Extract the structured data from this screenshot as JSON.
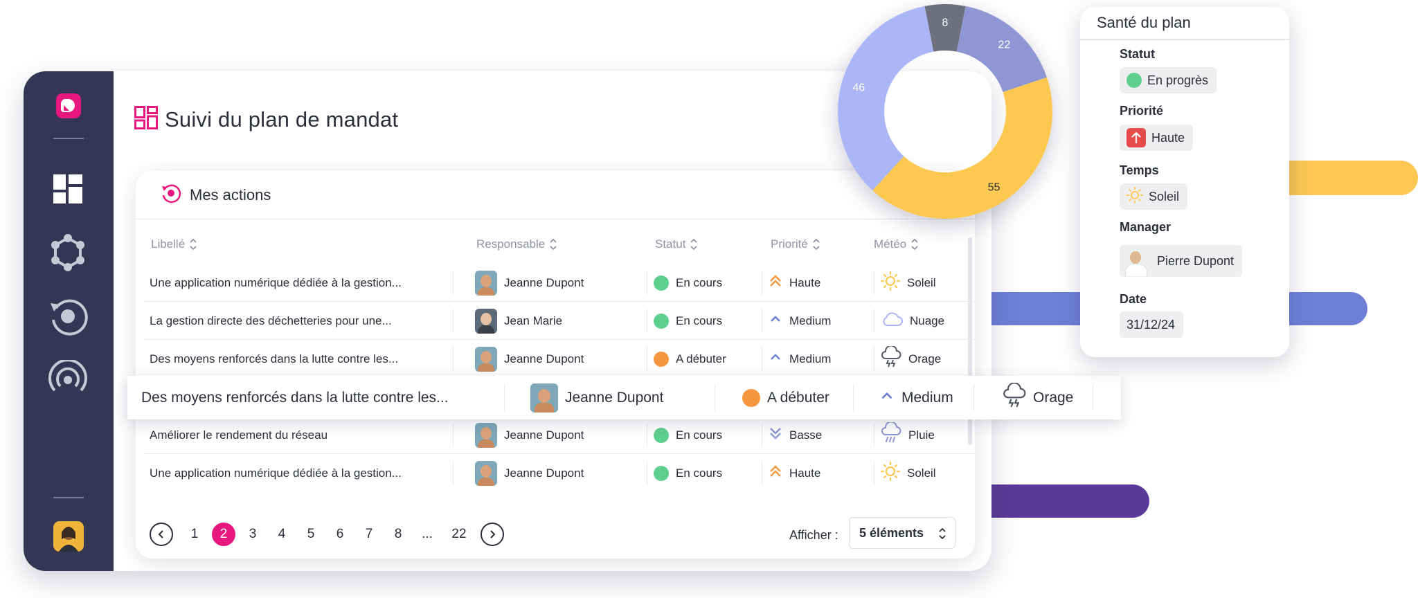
{
  "app": {
    "page_title": "Suivi du plan de mandat"
  },
  "table": {
    "title": "Mes actions",
    "columns": [
      "Libellé",
      "Responsable",
      "Statut",
      "Priorité",
      "Météo"
    ],
    "rows": [
      {
        "label": "Une application numérique dédiée à la gestion...",
        "owner": "Jeanne Dupont",
        "status": "En cours",
        "status_color": "#5fcf8f",
        "priority": "Haute",
        "weather": "Soleil"
      },
      {
        "label": "La gestion directe des déchetteries pour une...",
        "owner": "Jean Marie",
        "status": "En cours",
        "status_color": "#5fcf8f",
        "priority": "Medium",
        "weather": "Nuage"
      },
      {
        "label": "Des moyens renforcés dans la lutte contre les...",
        "owner": "Jeanne Dupont",
        "status": "A débuter",
        "status_color": "#f6973f",
        "priority": "Medium",
        "weather": "Orage"
      },
      {
        "label": "Améliorer le rendement du réseau",
        "owner": "Jeanne Dupont",
        "status": "En cours",
        "status_color": "#5fcf8f",
        "priority": "Basse",
        "weather": "Pluie"
      },
      {
        "label": "Une application numérique dédiée à la gestion...",
        "owner": "Jeanne Dupont",
        "status": "En cours",
        "status_color": "#5fcf8f",
        "priority": "Haute",
        "weather": "Soleil"
      }
    ],
    "highlight": {
      "label": "Des moyens renforcés dans la lutte contre les...",
      "owner": "Jeanne Dupont",
      "status": "A débuter",
      "status_color": "#f6973f",
      "priority": "Medium",
      "weather": "Orage"
    }
  },
  "pagination": {
    "pages": [
      "1",
      "2",
      "3",
      "4",
      "5",
      "6",
      "7",
      "8",
      "...",
      "22"
    ],
    "current": "2",
    "show_label": "Afficher :",
    "page_size": "5 éléments"
  },
  "donut": {
    "segments": [
      {
        "value": 8,
        "color": "#6e717d"
      },
      {
        "value": 22,
        "color": "#8e97d3"
      },
      {
        "value": 55,
        "color": "#fdc850"
      },
      {
        "value": 46,
        "color": "#aab6f6"
      }
    ]
  },
  "health": {
    "title": "Santé du plan",
    "status_label": "Statut",
    "status_value": "En progrès",
    "status_color": "#5fcf8f",
    "priority_label": "Priorité",
    "priority_value": "Haute",
    "time_label": "Temps",
    "time_value": "Soleil",
    "manager_label": "Manager",
    "manager_value": "Pierre Dupont",
    "date_label": "Date",
    "date_value": "31/12/24"
  },
  "colors": {
    "accent": "#e8177d",
    "sidebar": "#353653"
  }
}
